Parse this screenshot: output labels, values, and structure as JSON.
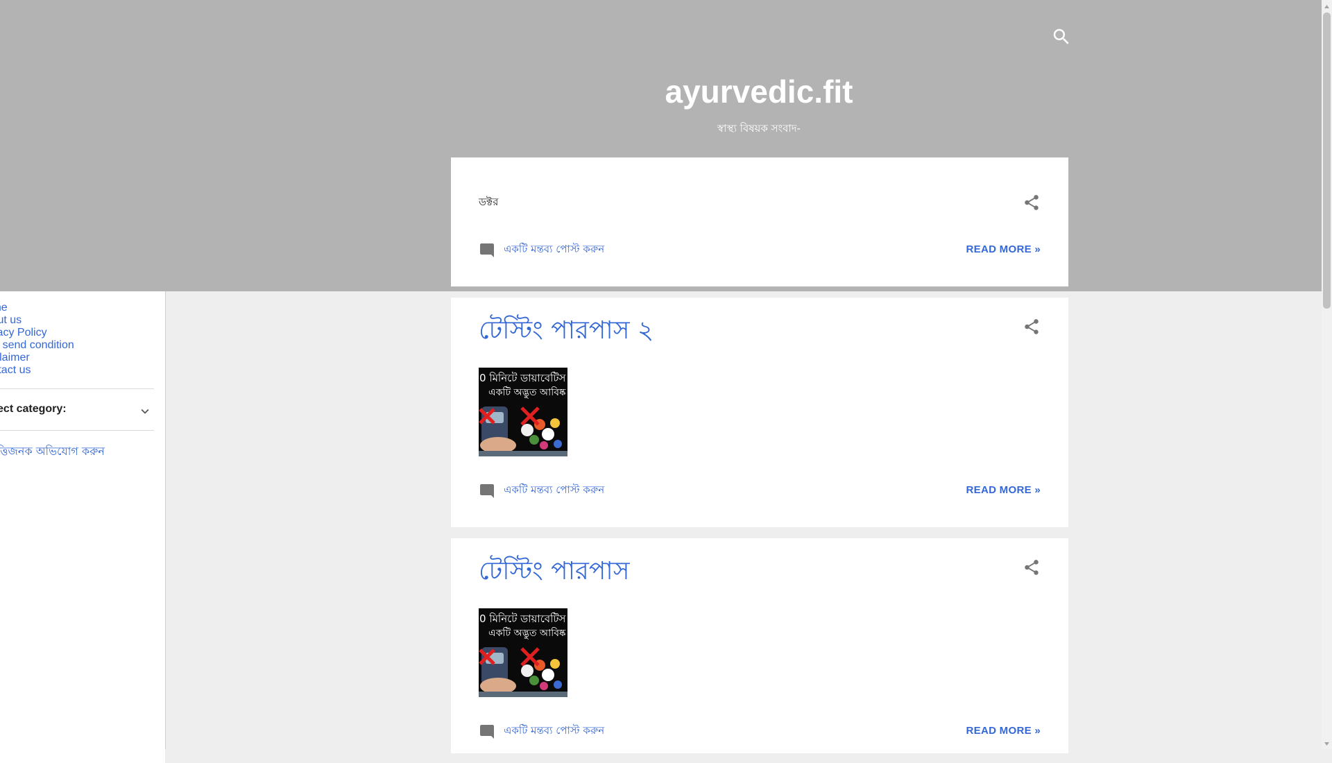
{
  "header": {
    "site_title": "ayurvedic.fit",
    "site_description": "স্বাস্থ্য বিষয়ক সংবাদ-",
    "search_icon": "search-icon"
  },
  "sidebar": {
    "pages": [
      {
        "label": "Home"
      },
      {
        "label": "About us"
      },
      {
        "label": "Privacy Policy"
      },
      {
        "label": "Item send condition"
      },
      {
        "label": "Disclaimer"
      },
      {
        "label": "Contact us"
      }
    ],
    "category_label": "Select category:",
    "report_link": "আপত্তিজনক অভিযোগ করুন"
  },
  "posts": [
    {
      "category": "ডক্টর",
      "title": "",
      "comment_label": "একটি মন্তব্য পোস্ট করুন",
      "read_more": "READ MORE »"
    },
    {
      "category": "",
      "title": "টেস্টিং পারপাস ২",
      "thumb_text_line1": "0 মিনিটে ডায়াবেটিস",
      "thumb_text_line2": "একটি অদ্ভুত আবিষ্ক",
      "comment_label": "একটি মন্তব্য পোস্ট করুন",
      "read_more": "READ MORE »"
    },
    {
      "category": "",
      "title": "টেস্টিং পারপাস",
      "thumb_text_line1": "0 মিনিটে ডায়াবেটিস",
      "thumb_text_line2": "একটি অদ্ভুত আবিষ্ক",
      "comment_label": "একটি মন্তব্য পোস্ট করুন",
      "read_more": "READ MORE »"
    }
  ],
  "colors": {
    "header_background": "#b3b3b3",
    "page_background": "#eeeeee",
    "link": "#3367d6",
    "icon": "#757575"
  }
}
